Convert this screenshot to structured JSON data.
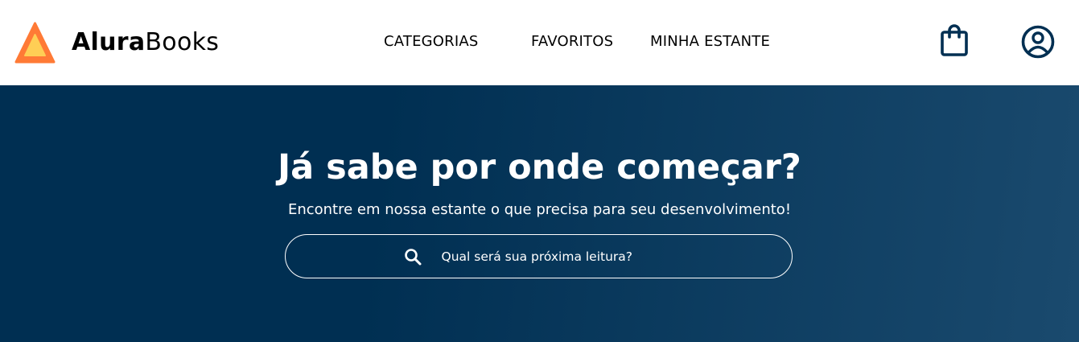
{
  "header": {
    "logo": {
      "name_bold": "Alura",
      "name_light": "Books",
      "icon": "triangle-logo-icon"
    },
    "nav": [
      {
        "label": "CATEGORIAS"
      },
      {
        "label": "FAVORITOS"
      },
      {
        "label": "MINHA ESTANTE"
      }
    ],
    "icons": {
      "bag": "shopping-bag-icon",
      "user": "user-account-icon"
    }
  },
  "hero": {
    "title": "Já sabe por onde começar?",
    "subtitle": "Encontre em nossa estante o que precisa para seu desenvolvimento!",
    "search": {
      "placeholder": "Qual será sua próxima leitura?",
      "value": "",
      "icon": "search-icon"
    }
  },
  "colors": {
    "header_background": "#ffffff",
    "hero_background": "#002f52",
    "hero_gradient_end": "#1a4a6e",
    "logo_orange": "#ff7a36",
    "logo_yellow": "#ffce55",
    "icon_navy": "#002f52",
    "text_dark": "#000000",
    "text_light": "#ffffff"
  }
}
